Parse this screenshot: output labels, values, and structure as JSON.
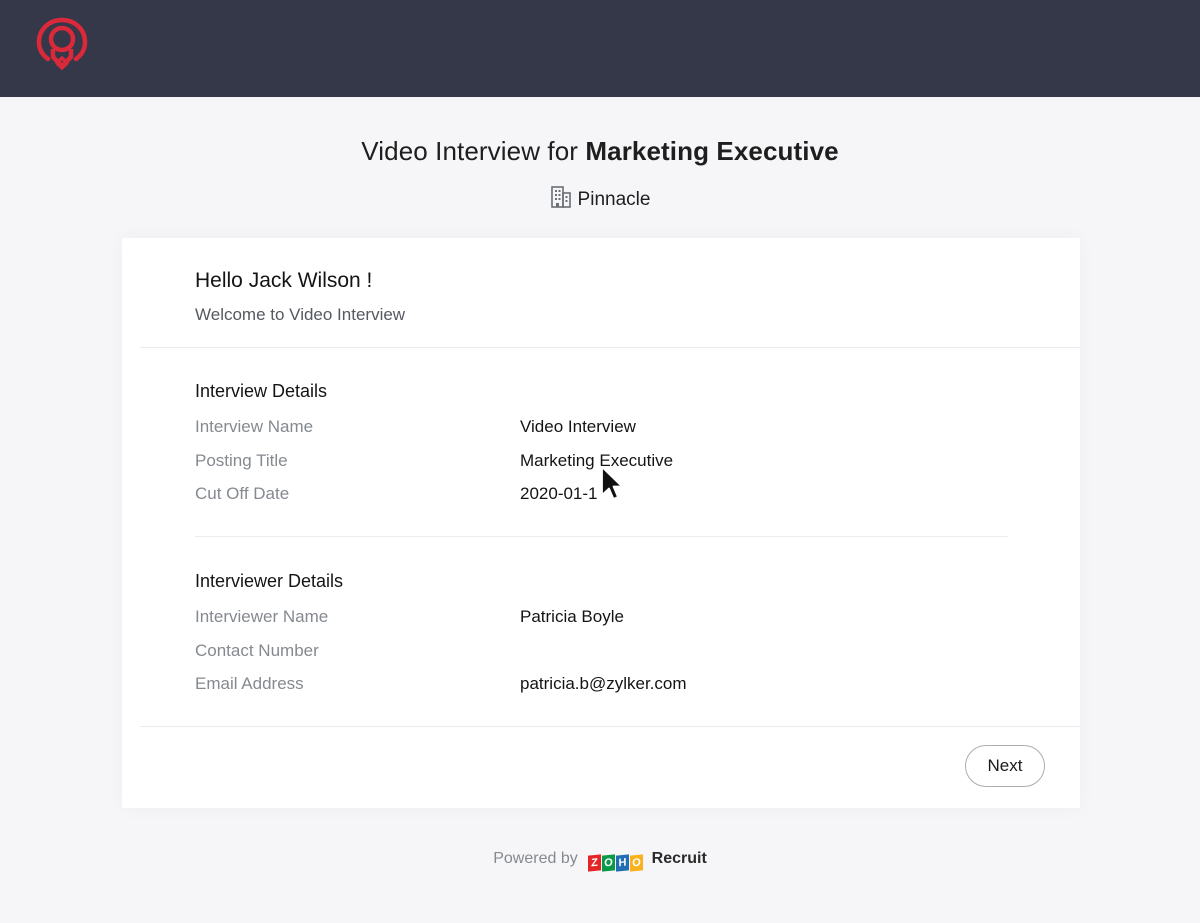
{
  "header": {
    "logo_icon": "location-pin-logo-icon",
    "brand_color": "#d9293a",
    "bg_color": "#353849"
  },
  "page": {
    "title_prefix": "Video Interview for",
    "title_job": "Marketing Executive",
    "company_icon": "building-icon",
    "company": "Pinnacle"
  },
  "greeting": {
    "hello": "Hello Jack Wilson !",
    "welcome": "Welcome to Video Interview"
  },
  "interview_details": {
    "heading": "Interview Details",
    "rows": [
      {
        "label": "Interview Name",
        "value": "Video Interview"
      },
      {
        "label": "Posting Title",
        "value": "Marketing Executive"
      },
      {
        "label": "Cut Off Date",
        "value": "2020-01-1"
      }
    ]
  },
  "interviewer_details": {
    "heading": "Interviewer Details",
    "rows": [
      {
        "label": "Interviewer Name",
        "value": "Patricia Boyle"
      },
      {
        "label": "Contact Number",
        "value": ""
      },
      {
        "label": "Email Address",
        "value": "patricia.b@zylker.com"
      }
    ]
  },
  "actions": {
    "next_label": "Next"
  },
  "footer": {
    "powered_by": "Powered by",
    "zoho_letters": [
      "Z",
      "O",
      "H",
      "O"
    ],
    "zoho_colors": [
      "#e42527",
      "#089949",
      "#226db4",
      "#f9b21d"
    ],
    "product": "Recruit"
  }
}
